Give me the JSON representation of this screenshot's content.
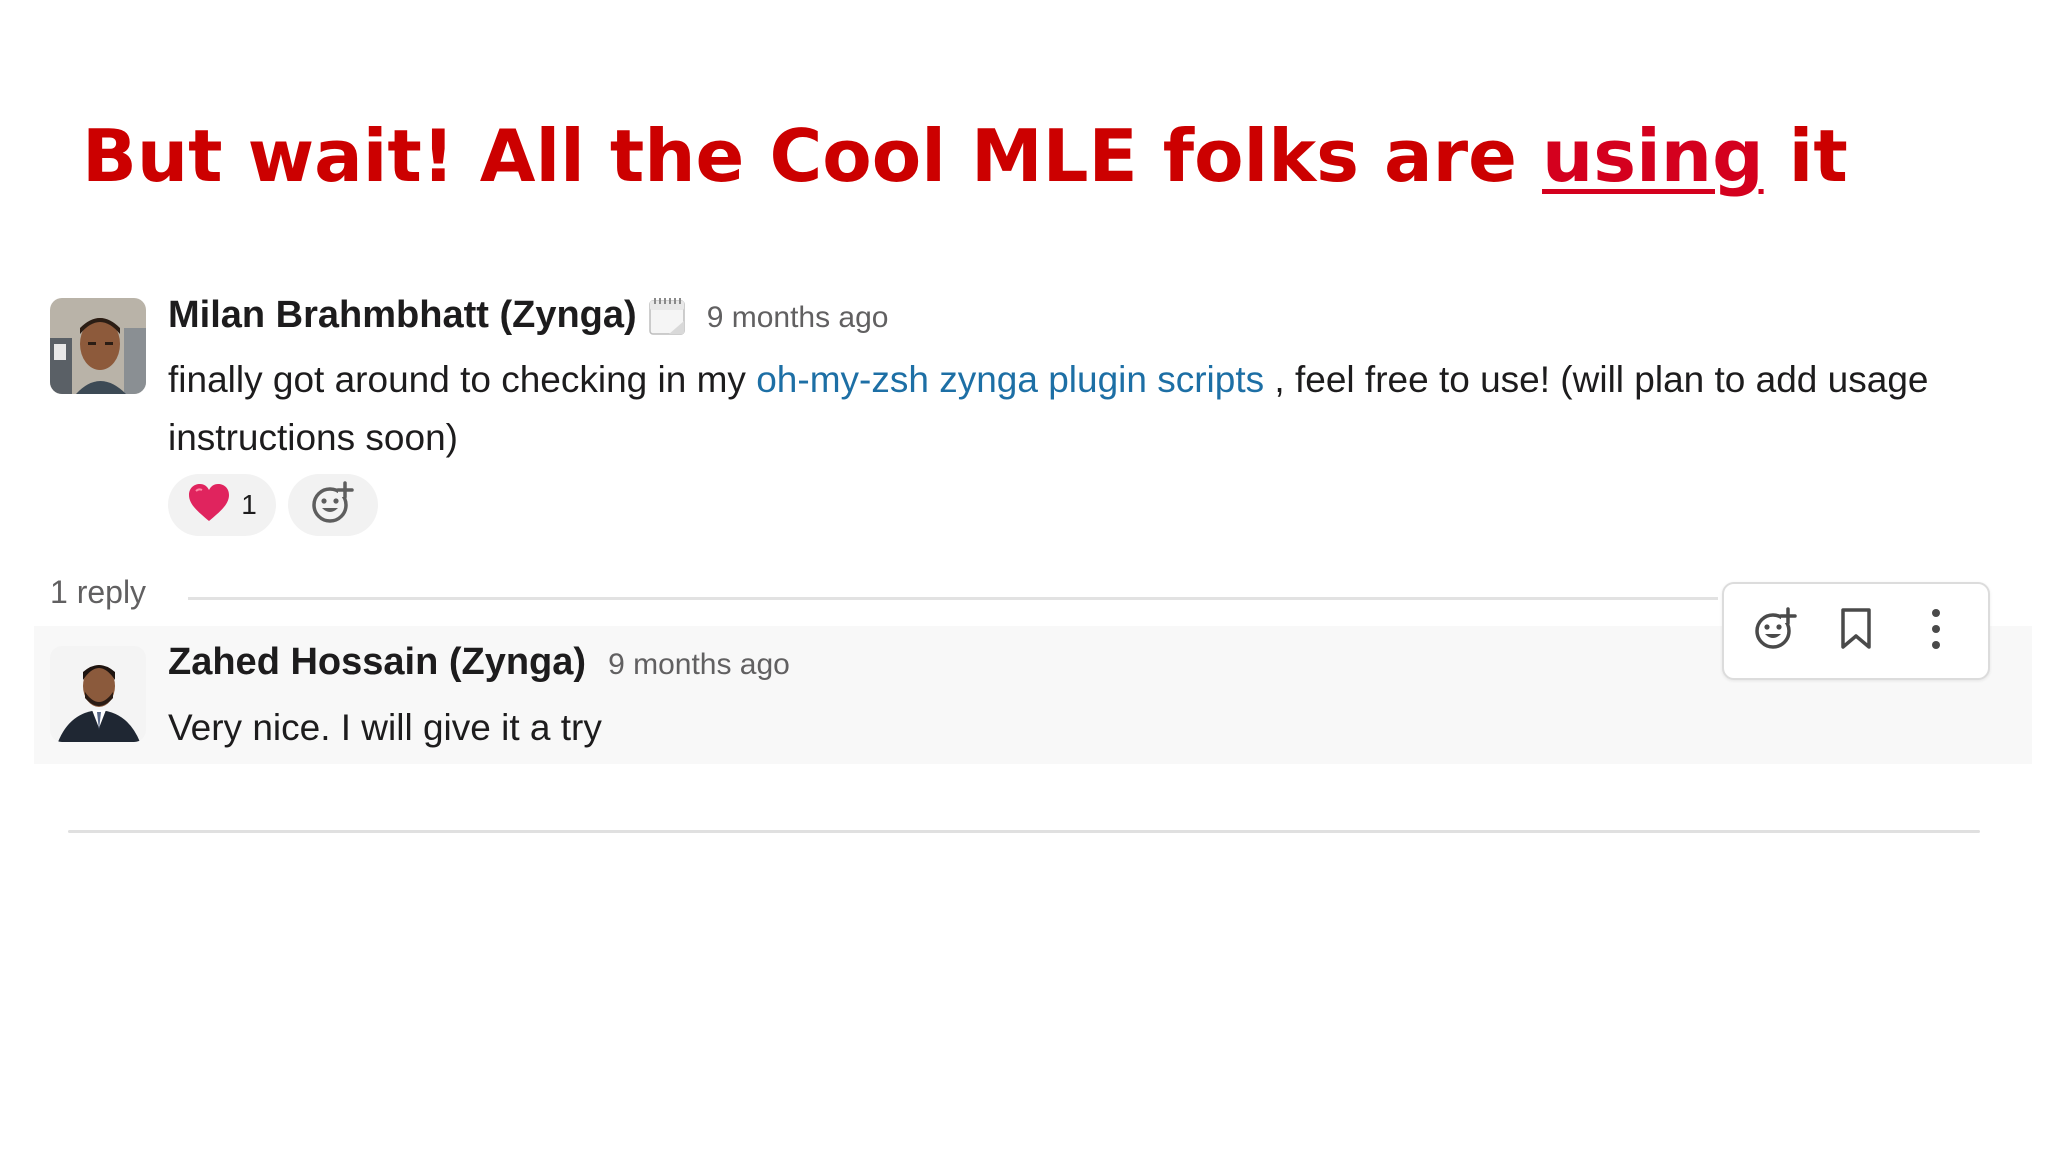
{
  "slide": {
    "title_before": "But wait! All the Cool MLE folks are ",
    "title_underlined": "using",
    "title_after": " it"
  },
  "message": {
    "author": "Milan Brahmbhatt (Zynga)",
    "status_icon": "calendar-icon",
    "timestamp": "9 months ago",
    "text_before": "finally got around to checking in my ",
    "link_text": "oh-my-zsh zynga plugin scripts",
    "text_after": " , feel free to use! (will plan to add usage instructions soon)",
    "reactions": [
      {
        "icon": "red-heart-icon",
        "count": "1"
      }
    ],
    "add_reaction_icon": "add-reaction-icon"
  },
  "thread": {
    "reply_count": "1 reply"
  },
  "reply": {
    "author": "Zahed Hossain (Zynga)",
    "timestamp": "9 months ago",
    "text": "Very nice. I will give it a try"
  },
  "hover_toolbar": {
    "icons": [
      "add-reaction-icon",
      "bookmark-icon",
      "more-vertical-icon"
    ]
  },
  "colors": {
    "title": "#cc0000",
    "link": "#1d6fa5",
    "heart": "#e0245e"
  }
}
